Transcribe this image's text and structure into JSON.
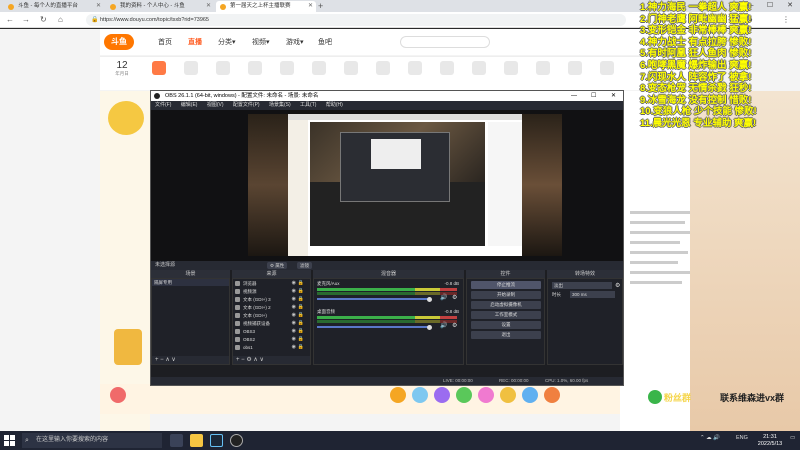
{
  "browser": {
    "tabs": [
      {
        "label": "斗鱼 - 每个人的直播平台",
        "active": false
      },
      {
        "label": "我的资料 - 个人中心 - 斗鱼",
        "active": false
      },
      {
        "label": "第一届天之上杯主播联赛",
        "active": true
      }
    ],
    "new_tab": "+",
    "url": "https://www.douyu.com/topic/tsxb?rid=73965",
    "window_controls": [
      "—",
      "☐",
      "✕"
    ]
  },
  "douyu": {
    "logo": "斗鱼",
    "nav": [
      {
        "label": "首页",
        "active": false
      },
      {
        "label": "直播",
        "active": true
      },
      {
        "label": "分类▾",
        "active": false
      },
      {
        "label": "视频▾",
        "active": false
      },
      {
        "label": "游戏▾",
        "active": false
      },
      {
        "label": "鱼吧",
        "active": false
      }
    ],
    "day": {
      "value": "12",
      "label": "年月日"
    },
    "gift_colors": [
      "#f06a6a",
      "#f5a623",
      "#7ec8f0",
      "#9b6cf0",
      "#5ac85a",
      "#f07ad0",
      "#f0c040",
      "#60b0f0",
      "#f08040"
    ]
  },
  "obs": {
    "title": "OBS 26.1.1 (64-bit, windows) - 配置文件: 未命名 - 场景: 未命名",
    "menu": [
      "文件(F)",
      "编辑(E)",
      "视图(V)",
      "配置文件(P)",
      "场景集(S)",
      "工具(T)",
      "帮助(H)"
    ],
    "title_controls": [
      "—",
      "☐",
      "✕"
    ],
    "state_bar": {
      "scene_label": "未选择源",
      "props": "⚙ 属性",
      "filters": "滤镜"
    },
    "docks": {
      "scenes": {
        "title": "场景",
        "items": [
          "隔屏专用"
        ]
      },
      "sources": {
        "title": "来源",
        "items": [
          "浏览器",
          "视频源",
          "文本 (GDI+) 3",
          "文本 (GDI+) 2",
          "文本 (GDI+)",
          "视频捕获设备",
          "OBS3",
          "OBS2",
          "obs1"
        ]
      },
      "mixer": {
        "title": "混音器",
        "channels": [
          {
            "name": "麦克风/Aux",
            "db": "-0.8 dB",
            "level": 0.78
          },
          {
            "name": "桌面音频",
            "db": "-0.8 dB",
            "level": 0.78
          }
        ]
      },
      "controls": {
        "title": "控件",
        "buttons": [
          {
            "label": "停止推流",
            "active": true
          },
          {
            "label": "开始录制",
            "active": false
          },
          {
            "label": "启动虚拟摄像机",
            "active": false
          },
          {
            "label": "工作室模式",
            "active": false
          },
          {
            "label": "设置",
            "active": false
          },
          {
            "label": "退出",
            "active": false
          }
        ]
      },
      "transitions": {
        "title": "转场特效",
        "selected": "淡出",
        "duration_label": "时长",
        "duration": "300 ms"
      }
    },
    "dock_foot": "+ − ∧ ∨",
    "status": {
      "live": "LIVE: 00:00:00",
      "rec": "REC: 00:00:00",
      "cpu": "CPU: 1.0%, 60.00 fps"
    }
  },
  "overlay": {
    "lines": [
      "1.神力海民 一拳超人 爽赢!",
      "2.门神老鹰 阿毗幽幽 猛赢!",
      "3.变形铠金 非常棒棒 爽赢!",
      "4.神力战士 有点拉胯 惨败!",
      "5.有时阿凰 狂人鱼肉 惨败!",
      "6.咆哮黑魔 爆炸输出 爽赢!",
      "7.闪现水人 阵容炸了 被拿!",
      "8.变态枪宠 无情杀戮 狂秒!",
      "9.冰雪海龙 没有控制 惜败!",
      "10.变狼人枪 少个技能 惨败!",
      "11.晨光光恩 专业辅助 爽赢!"
    ],
    "wechat_a": "粉丝群",
    "wechat_b": "联系维森进vx群"
  },
  "taskbar": {
    "search_placeholder": "在这里输入你要搜索的内容",
    "lang": "ENG",
    "time": "21:31",
    "date": "2022/5/13"
  }
}
